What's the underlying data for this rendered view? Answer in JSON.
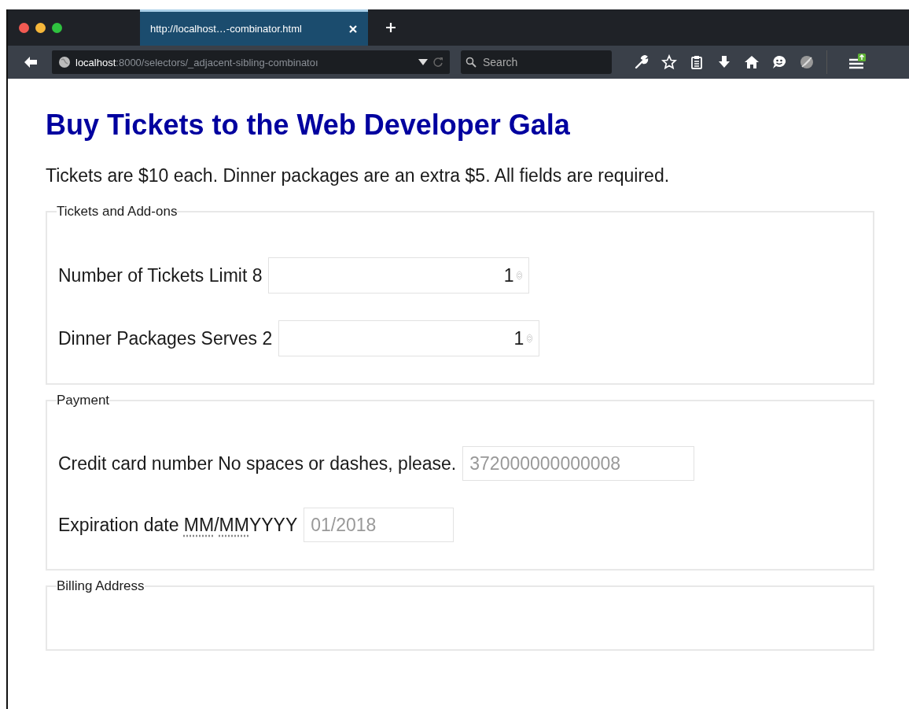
{
  "browser": {
    "tabs": [
      {
        "title": "http://localhost…-combinator.html",
        "selected": true
      }
    ],
    "address": {
      "host": "localhost",
      "path": ":8000/selectors/_adjacent-sibling-combinatoı"
    },
    "search": {
      "placeholder": "Search"
    }
  },
  "page": {
    "heading": "Buy Tickets to the Web Developer Gala",
    "intro": "Tickets are $10 each. Dinner packages are an extra $5. All fields are required.",
    "fieldsets": [
      {
        "legend": "Tickets and Add-ons",
        "fields": [
          {
            "kind": "number",
            "label": [
              {
                "text": "Number of Tickets Limit 8",
                "abbr": false
              }
            ],
            "value": "1"
          },
          {
            "kind": "number",
            "label": [
              {
                "text": "Dinner Packages Serves 2",
                "abbr": false
              }
            ],
            "value": "1"
          }
        ]
      },
      {
        "legend": "Payment",
        "fields": [
          {
            "kind": "text",
            "label": [
              {
                "text": "Credit card number No spaces or dashes, please.",
                "abbr": false
              }
            ],
            "placeholder": "372000000000008"
          },
          {
            "kind": "text",
            "label": [
              {
                "text": "Expiration date ",
                "abbr": false
              },
              {
                "text": "MM",
                "abbr": true
              },
              {
                "text": "/",
                "abbr": false
              },
              {
                "text": "MM",
                "abbr": true
              },
              {
                "text": "YYYY",
                "abbr": false
              }
            ],
            "placeholder": "01/2018"
          }
        ]
      },
      {
        "legend": "Billing Address"
      }
    ]
  }
}
